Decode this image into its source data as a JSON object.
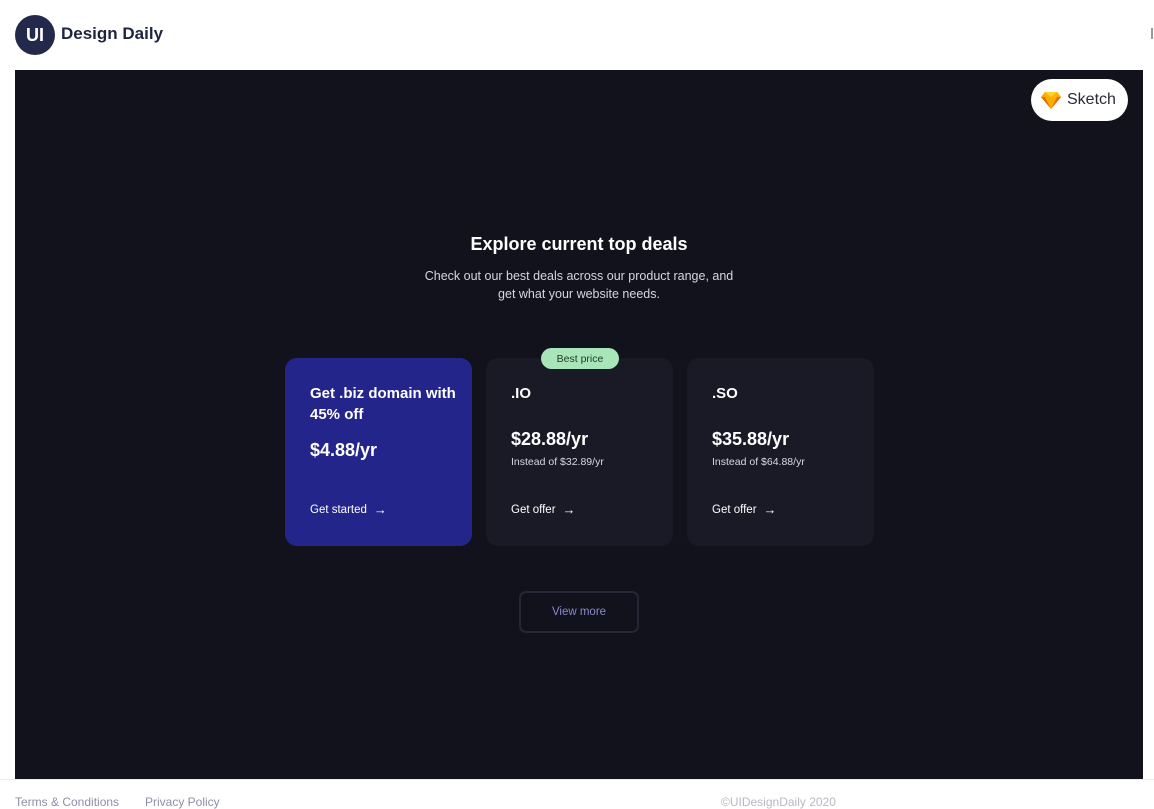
{
  "header": {
    "logo_mark": "UI",
    "brand_name": "Design Daily"
  },
  "sketch_button": {
    "label": "Sketch",
    "icon": "sketch-diamond-icon"
  },
  "hero": {
    "title": "Explore current top deals",
    "subtitle": "Check out our best deals across our product range, and get what your website needs."
  },
  "cards": [
    {
      "title": "Get .biz domain with 45% off",
      "price": "$4.88/yr",
      "old_price": "",
      "link_label": "Get started",
      "link_icon": "arrow-right-icon"
    },
    {
      "badge": "Best price",
      "title": ".IO",
      "price": "$28.88/yr",
      "old_price": "Instead of $32.89/yr",
      "link_label": "Get offer",
      "link_icon": "arrow-right-icon"
    },
    {
      "title": ".SO",
      "price": "$35.88/yr",
      "old_price": "Instead of $64.88/yr",
      "link_label": "Get offer",
      "link_icon": "arrow-right-icon"
    }
  ],
  "view_more_label": "View more",
  "footer": {
    "terms": "Terms & Conditions",
    "privacy": "Privacy Policy",
    "copyright": "©UIDesignDaily 2020"
  },
  "colors": {
    "brand_dark": "#22294a",
    "stage_background": "#12121c",
    "featured_card": "#24258a",
    "card_background": "#1a1a27",
    "badge_green": "#a8e6b9",
    "view_more_text": "#8b89c8"
  }
}
